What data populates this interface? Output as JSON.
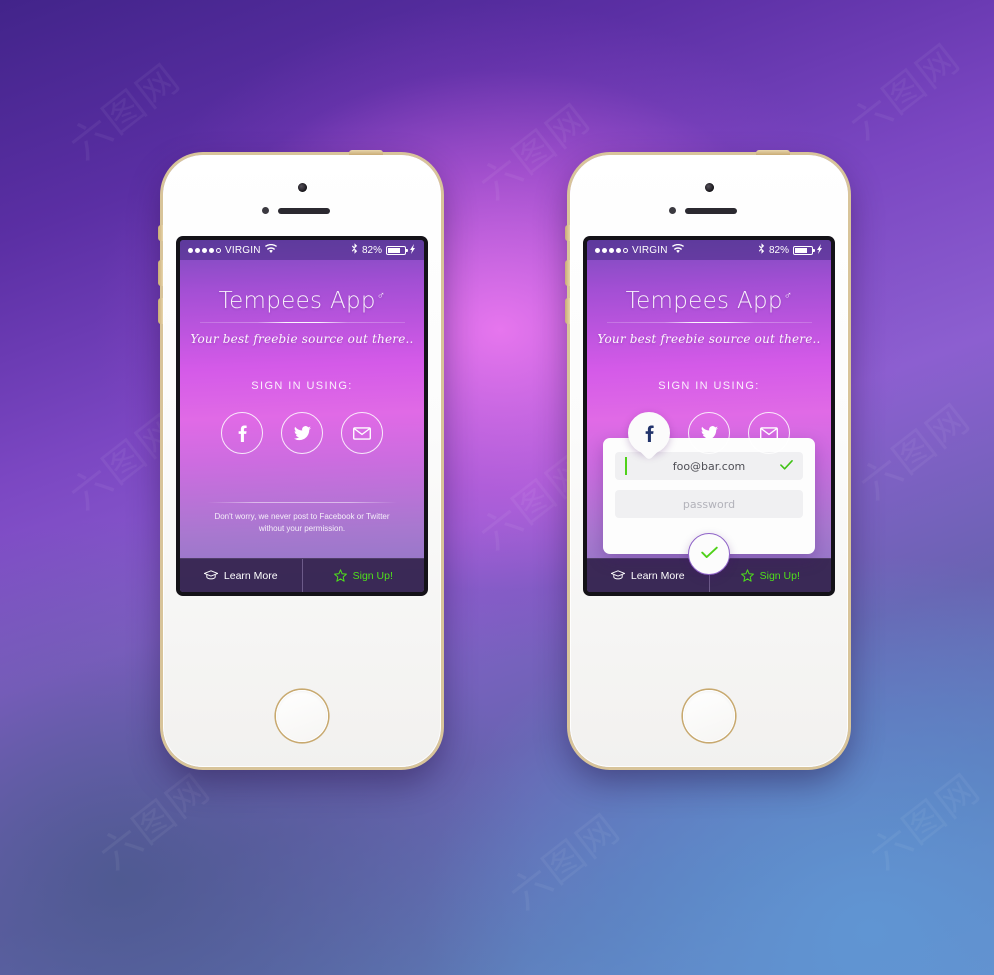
{
  "background": {
    "colors": [
      "#42248a",
      "#7b47c2",
      "#d45ae8",
      "#6b95cf",
      "#4a588c"
    ]
  },
  "watermark": {
    "text": "六图网"
  },
  "accents": {
    "green": "#4fd119",
    "purple": "#8f63c8",
    "facebook_blue": "#21336b",
    "screen_top": "#7a4bbd",
    "screen_mid": "#d45ae8",
    "tabbar": "#34244e"
  },
  "status_bar": {
    "signal_dots_filled": 4,
    "signal_dots_total": 5,
    "carrier": "VIRGIN",
    "wifi_icon": "wifi-icon",
    "bluetooth_icon": "bluetooth-icon",
    "battery_percent": "82%",
    "battery_level": 78,
    "charging_icon": "lightning-bolt-icon"
  },
  "app": {
    "title": "Tempees App",
    "title_superscript": "♂",
    "tagline": "Your best freebie source out there..",
    "signin_label": "SIGN IN USING:",
    "disclaimer_line1": "Don't worry, we never post to Facebook or Twitter",
    "disclaimer_line2": "without your permission."
  },
  "social_buttons": [
    {
      "name": "facebook",
      "icon": "facebook-icon",
      "label": "Facebook"
    },
    {
      "name": "twitter",
      "icon": "twitter-icon",
      "label": "Twitter"
    },
    {
      "name": "email",
      "icon": "envelope-icon",
      "label": "Email"
    }
  ],
  "login_form": {
    "email_value": "foo@bar.com",
    "email_valid_icon": "check-icon",
    "password_placeholder": "password",
    "submit_icon": "check-icon"
  },
  "tabbar": {
    "learn_more": {
      "label": "Learn More",
      "icon": "graduation-cap-icon"
    },
    "sign_up": {
      "label": "Sign Up!",
      "icon": "star-icon"
    }
  },
  "phones": [
    {
      "id": "left",
      "state": "default"
    },
    {
      "id": "right",
      "state": "login-open"
    }
  ]
}
